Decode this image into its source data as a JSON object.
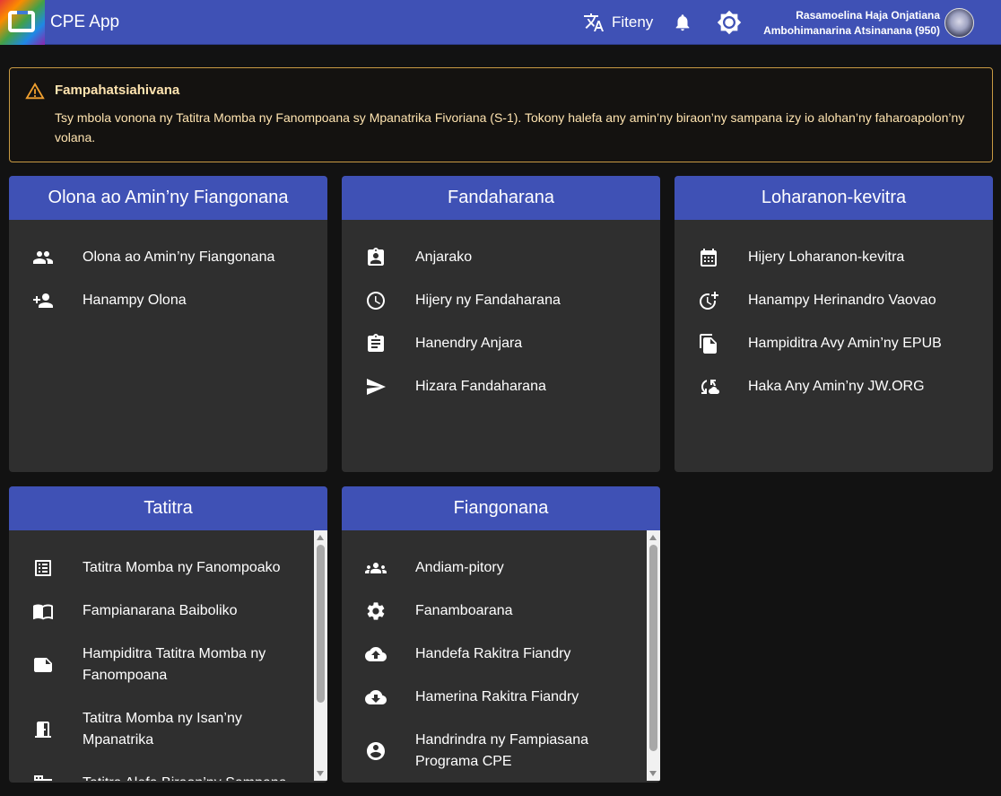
{
  "app": {
    "title": "CPE App"
  },
  "header": {
    "language_label": "Fiteny",
    "user_name": "Rasamoelina Haja Onjatiana",
    "congregation": "Ambohimanarina Atsinanana (950)"
  },
  "warning": {
    "title": "Fampahatsiahivana",
    "text": "Tsy mbola vonona ny Tatitra Momba ny Fanompoana sy Mpanatrika Fivoriana (S-1). Tokony halefa any amin’ny biraon’ny sampana izy io alohan’ny faharoapolon’ny volana."
  },
  "cards": {
    "persons": {
      "title": "Olona ao Amin’ny Fiangonana",
      "items": [
        "Olona ao Amin’ny Fiangonana",
        "Hanampy Olona"
      ]
    },
    "assignments": {
      "title": "Fandaharana",
      "items": [
        "Anjarako",
        "Hijery ny Fandaharana",
        "Hanendry Anjara",
        "Hizara Fandaharana"
      ]
    },
    "sources": {
      "title": "Loharanon-kevitra",
      "items": [
        "Hijery Loharanon-kevitra",
        "Hanampy Herinandro Vaovao",
        "Hampiditra Avy Amin’ny EPUB",
        "Haka Any Amin’ny JW.ORG"
      ]
    },
    "reports": {
      "title": "Tatitra",
      "items": [
        "Tatitra Momba ny Fanompoako",
        "Fampianarana Baiboliko",
        "Hampiditra Tatitra Momba ny Fanompoana",
        "Tatitra Momba ny Isan’ny Mpanatrika",
        "Tatitra Alefa Biraon’ny Sampana"
      ]
    },
    "congregation": {
      "title": "Fiangonana",
      "items": [
        "Andiam-pitory",
        "Fanamboarana",
        "Handefa Rakitra Fiandry",
        "Hamerina Rakitra Fiandry",
        "Handrindra ny Fampiasana Programa CPE"
      ]
    }
  },
  "icons": {
    "language": "translate-icon",
    "bell": "notifications-icon",
    "theme": "brightness-icon",
    "warning": "warning-icon"
  },
  "colors": {
    "primary": "#3f51b5",
    "background": "#121212",
    "card": "#2f2f2f",
    "warning_border": "#c89a43"
  }
}
